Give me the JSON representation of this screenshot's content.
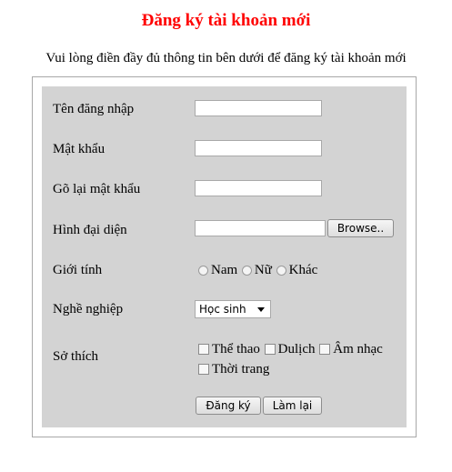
{
  "header": {
    "title": "Đăng ký tài khoản mới",
    "title_color": "#ff0000",
    "subtitle": "Vui lòng điền đầy đủ thông tin bên dưới để đăng ký tài khoản mới"
  },
  "form": {
    "panel_color": "#d3d3d3",
    "username": {
      "label": "Tên đăng nhập",
      "value": ""
    },
    "password": {
      "label": "Mật khẩu",
      "value": ""
    },
    "password_confirm": {
      "label": "Gõ lại mật khẩu",
      "value": ""
    },
    "avatar": {
      "label": "Hình đại diện",
      "value": "",
      "browse_label": "Browse.."
    },
    "gender": {
      "label": "Giới tính",
      "options": [
        "Nam",
        "Nữ",
        "Khác"
      ]
    },
    "occupation": {
      "label": "Nghề nghiệp",
      "selected": "Học sinh"
    },
    "hobbies": {
      "label": "Sở thích",
      "options": [
        "Thể thao",
        "Dulịch",
        "Âm nhạc",
        "Thời trang"
      ]
    },
    "submit_label": "Đăng ký",
    "reset_label": "Làm lại"
  }
}
